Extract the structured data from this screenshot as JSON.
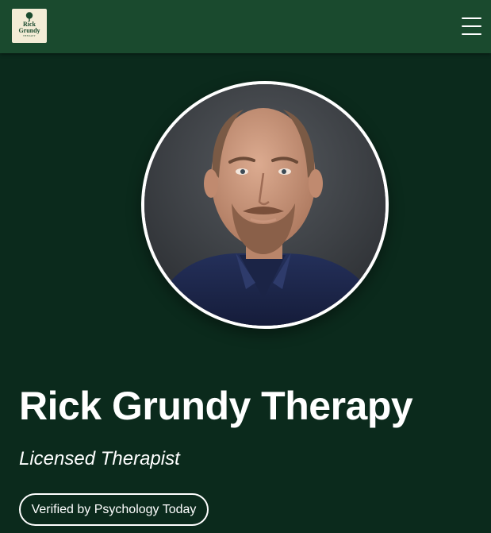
{
  "header": {
    "logo": {
      "line1": "Rick",
      "line2": "Grundy",
      "line3": "THERAPY",
      "icon": "tree-icon"
    },
    "menu_icon": "hamburger-menu-icon"
  },
  "hero": {
    "portrait_alt": "Rick Grundy",
    "name": "Rick Grundy Therapy",
    "subtitle": "Licensed Therapist",
    "verified_label": "Verified by Psychology Today"
  },
  "colors": {
    "navbar": "#1a4a2e",
    "background": "#0b2a1c",
    "text": "#ffffff",
    "logo_bg": "#f3ecd6"
  }
}
